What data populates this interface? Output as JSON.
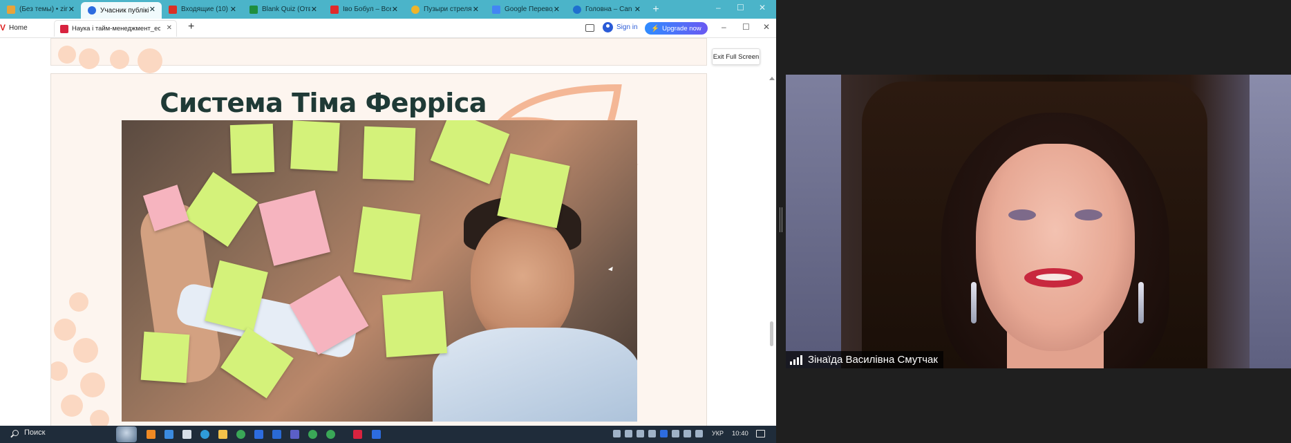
{
  "browser": {
    "tabs": [
      {
        "label": "(Без темы) • zin",
        "icon_color": "#e8a33a",
        "active": false
      },
      {
        "label": "Учасник публікі",
        "icon_color": "#2d6cdf",
        "active": true
      },
      {
        "label": "Входящие (10)",
        "icon_color": "#d93025",
        "active": false
      },
      {
        "label": "Blank Quiz (Отв",
        "icon_color": "#1e8e3e",
        "active": false
      },
      {
        "label": "Іво Бобул – Все",
        "icon_color": "#e02a2a",
        "active": false
      },
      {
        "label": "Пузыри стреля",
        "icon_color": "#f0b429",
        "active": false
      },
      {
        "label": "Google Перевод",
        "icon_color": "#4285f4",
        "active": false
      },
      {
        "label": "Головна – Can",
        "icon_color": "#1f6fcf",
        "active": false
      }
    ],
    "new_tab": "+",
    "window_controls": [
      "–",
      "☐",
      "✕"
    ]
  },
  "viewer_app": {
    "home_label": "Home",
    "doc_tab_label": "Наука і тайм-менеджмент_ес",
    "add_label": "+",
    "signin_label": "Sign in",
    "upgrade_label": "Upgrade now",
    "window_controls": [
      "–",
      "☐",
      "✕"
    ],
    "exit_fullscreen_label": "Exit Full Screen"
  },
  "slide": {
    "title": "Система Тіма Ферріса",
    "image": "man-with-sticky-notes",
    "accent": "#f3b08c"
  },
  "taskbar": {
    "search_label": "Поиск",
    "language": "УКР",
    "time": "10:40"
  },
  "video": {
    "participant_name": "Зінаїда Василівна Смутчак",
    "signal_icon": "signal-bars-icon"
  }
}
